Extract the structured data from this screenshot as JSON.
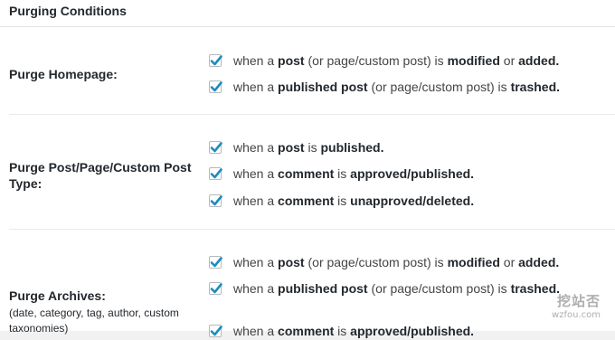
{
  "section_title": "Purging Conditions",
  "rows": [
    {
      "label": "Purge Homepage:",
      "sublabel": "",
      "options": [
        {
          "checked": true,
          "parts": [
            [
              "when a ",
              false
            ],
            [
              "post",
              true
            ],
            [
              " (or page/custom post) is ",
              false
            ],
            [
              "modified",
              true
            ],
            [
              " or ",
              false
            ],
            [
              "added.",
              true
            ]
          ]
        },
        {
          "checked": true,
          "parts": [
            [
              "when a ",
              false
            ],
            [
              "published post",
              true
            ],
            [
              " (or page/custom post) is ",
              false
            ],
            [
              "trashed.",
              true
            ]
          ]
        }
      ]
    },
    {
      "label": "Purge Post/Page/Custom Post Type:",
      "sublabel": "",
      "options": [
        {
          "checked": true,
          "parts": [
            [
              "when a ",
              false
            ],
            [
              "post",
              true
            ],
            [
              " is ",
              false
            ],
            [
              "published.",
              true
            ]
          ]
        },
        {
          "checked": true,
          "parts": [
            [
              "when a ",
              false
            ],
            [
              "comment",
              true
            ],
            [
              " is ",
              false
            ],
            [
              "approved/published.",
              true
            ]
          ]
        },
        {
          "checked": true,
          "parts": [
            [
              "when a ",
              false
            ],
            [
              "comment",
              true
            ],
            [
              " is ",
              false
            ],
            [
              "unapproved/deleted.",
              true
            ]
          ]
        }
      ]
    },
    {
      "label": "Purge Archives:",
      "sublabel": "(date, category, tag, author, custom taxonomies)",
      "options": [
        {
          "checked": true,
          "parts": [
            [
              "when a ",
              false
            ],
            [
              "post",
              true
            ],
            [
              " (or page/custom post) is ",
              false
            ],
            [
              "modified",
              true
            ],
            [
              " or ",
              false
            ],
            [
              "added.",
              true
            ]
          ]
        },
        {
          "checked": true,
          "parts": [
            [
              "when a ",
              false
            ],
            [
              "published post",
              true
            ],
            [
              " (or page/custom post) is ",
              false
            ],
            [
              "trashed.",
              true
            ]
          ]
        },
        {
          "checked": true,
          "parts": [
            [
              "when a ",
              false
            ],
            [
              "comment",
              true
            ],
            [
              " is ",
              false
            ],
            [
              "approved/published.",
              true
            ]
          ]
        }
      ]
    }
  ],
  "watermark": {
    "cn": "挖站否",
    "en": "wzfou.com"
  },
  "colors": {
    "check": "#1e8cbe",
    "checkbox_border": "#b4b9be",
    "separator": "#eaeaea"
  }
}
